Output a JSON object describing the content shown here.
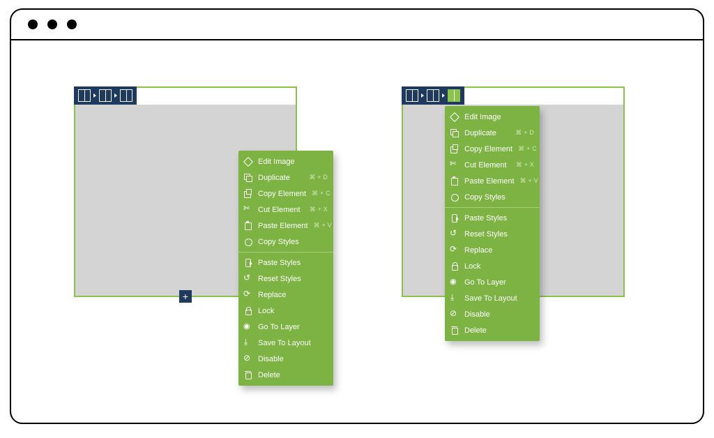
{
  "colors": {
    "accent": "#7cb342",
    "nav": "#1e3a5f"
  },
  "add_label": "+",
  "menu": {
    "items": [
      {
        "icon": "ic-edit",
        "name": "edit-image",
        "label": "Edit Image",
        "shortcut": ""
      },
      {
        "icon": "ic-dup",
        "name": "duplicate",
        "label": "Duplicate",
        "shortcut": "⌘ + D"
      },
      {
        "icon": "ic-copy",
        "name": "copy-element",
        "label": "Copy Element",
        "shortcut": "⌘ + C"
      },
      {
        "icon": "ic-cut",
        "name": "cut-element",
        "label": "Cut Element",
        "shortcut": "⌘ + X"
      },
      {
        "icon": "ic-paste",
        "name": "paste-element",
        "label": "Paste Element",
        "shortcut": "⌘ + V"
      },
      {
        "icon": "ic-cpstyle",
        "name": "copy-styles",
        "label": "Copy Styles",
        "shortcut": ""
      },
      {
        "sep": true
      },
      {
        "icon": "ic-ptstyle",
        "name": "paste-styles",
        "label": "Paste Styles",
        "shortcut": ""
      },
      {
        "icon": "ic-reset",
        "name": "reset-styles",
        "label": "Reset Styles",
        "shortcut": ""
      },
      {
        "icon": "ic-replace",
        "name": "replace",
        "label": "Replace",
        "shortcut": ""
      },
      {
        "icon": "ic-lock",
        "name": "lock",
        "label": "Lock",
        "shortcut": ""
      },
      {
        "icon": "ic-layer",
        "name": "go-to-layer",
        "label": "Go To Layer",
        "shortcut": ""
      },
      {
        "icon": "ic-save",
        "name": "save-to-layout",
        "label": "Save To Layout",
        "shortcut": ""
      },
      {
        "icon": "ic-disable",
        "name": "disable",
        "label": "Disable",
        "shortcut": ""
      },
      {
        "icon": "ic-delete",
        "name": "delete",
        "label": "Delete",
        "shortcut": ""
      }
    ]
  }
}
